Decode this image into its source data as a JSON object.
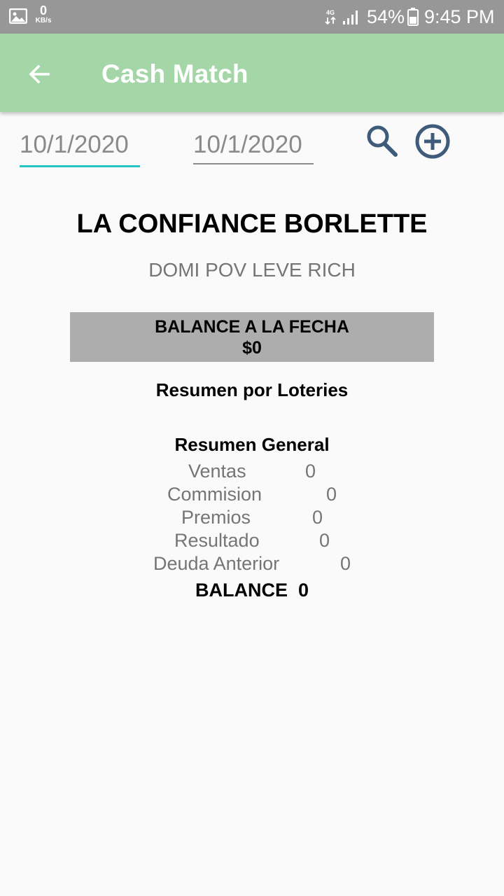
{
  "status_bar": {
    "kbs_value": "0",
    "kbs_unit": "KB/s",
    "network_label": "4G",
    "battery_percent": "54%",
    "time": "9:45 PM"
  },
  "app_bar": {
    "title": "Cash Match",
    "color": "#a5d6a7"
  },
  "filters": {
    "from_date": "10/1/2020",
    "to_date": "10/1/2020"
  },
  "header": {
    "company": "LA CONFIANCE BORLETTE",
    "subtitle": "DOMI POV LEVE RICH"
  },
  "balance_box": {
    "label": "BALANCE A LA FECHA",
    "amount": "$0"
  },
  "sections": {
    "lotteries_title": "Resumen por Loteries",
    "general_title": "Resumen General"
  },
  "summary": {
    "rows": [
      {
        "label": "Ventas",
        "value": "0"
      },
      {
        "label": "Commision",
        "value": "0"
      },
      {
        "label": "Premios",
        "value": "0"
      },
      {
        "label": "Resultado",
        "value": "0"
      },
      {
        "label": "Deuda Anterior",
        "value": "0"
      }
    ],
    "balance_label": "BALANCE",
    "balance_value": "0"
  },
  "icons": {
    "back": "arrow-left-icon",
    "search": "search-icon",
    "add": "add-circle-icon"
  },
  "colors": {
    "accent": "#26c6c6",
    "icon": "#3f5b7a",
    "balance_box": "#adadad"
  }
}
